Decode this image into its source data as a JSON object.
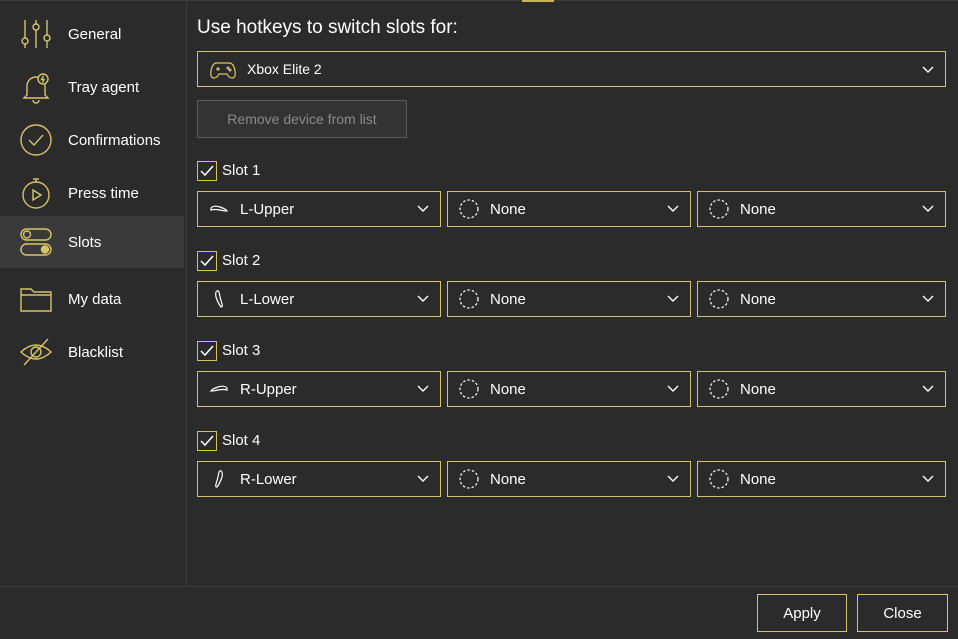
{
  "sidebar": {
    "items": [
      {
        "label": "General",
        "icon": "sliders-icon"
      },
      {
        "label": "Tray agent",
        "icon": "bell-icon"
      },
      {
        "label": "Confirmations",
        "icon": "check-circle-icon"
      },
      {
        "label": "Press time",
        "icon": "stopwatch-icon"
      },
      {
        "label": "Slots",
        "icon": "toggles-icon",
        "active": true
      },
      {
        "label": "My data",
        "icon": "folder-icon"
      },
      {
        "label": "Blacklist",
        "icon": "eye-off-icon"
      }
    ]
  },
  "main": {
    "heading": "Use hotkeys to switch slots for:",
    "device": {
      "label": "Xbox Elite 2",
      "icon": "gamepad-icon"
    },
    "remove_button": "Remove device from list",
    "slots": [
      {
        "label": "Slot 1",
        "checked": true,
        "selects": [
          "L-Upper",
          "None",
          "None"
        ]
      },
      {
        "label": "Slot 2",
        "checked": true,
        "selects": [
          "L-Lower",
          "None",
          "None"
        ]
      },
      {
        "label": "Slot 3",
        "checked": true,
        "selects": [
          "R-Upper",
          "None",
          "None"
        ]
      },
      {
        "label": "Slot 4",
        "checked": true,
        "selects": [
          "R-Lower",
          "None",
          "None"
        ]
      }
    ]
  },
  "footer": {
    "apply_label": "Apply",
    "close_label": "Close"
  },
  "colors": {
    "accent": "#d6c46a",
    "background": "#2b2b2b",
    "active_nav": "#3a3a3a"
  }
}
